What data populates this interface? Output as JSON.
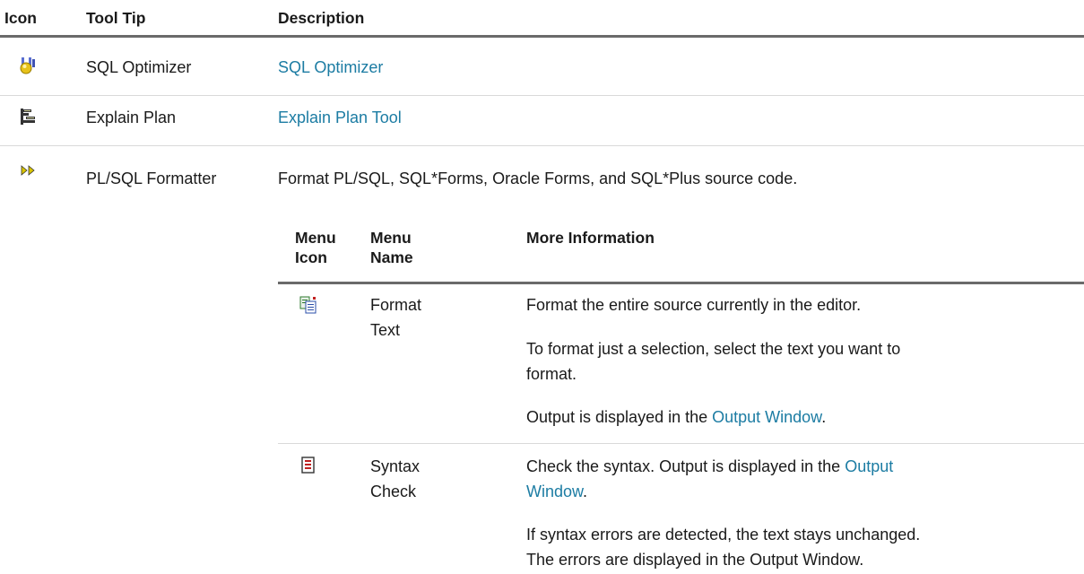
{
  "header": {
    "icon": "Icon",
    "tooltip": "Tool Tip",
    "description": "Description"
  },
  "rows": [
    {
      "icon": "sql-optimizer-icon",
      "tooltip": "SQL Optimizer",
      "link": "SQL Optimizer"
    },
    {
      "icon": "explain-plan-icon",
      "tooltip": "Explain Plan",
      "link": "Explain Plan Tool"
    },
    {
      "icon": "formatter-icon",
      "tooltip": "PL/SQL Formatter",
      "description": "Format PL/SQL, SQL*Forms, Oracle Forms, and SQL*Plus source code."
    }
  ],
  "inner": {
    "header": {
      "menu_icon_1": "Menu",
      "menu_icon_2": "Icon",
      "menu_name_1": "Menu",
      "menu_name_2": "Name",
      "more_info": "More Information"
    },
    "rows": [
      {
        "icon": "format-text-icon",
        "name_1": "Format",
        "name_2": "Text",
        "p1": "Format the entire source currently in the editor.",
        "p2_line1": "To format just a selection, select the text you want to",
        "p2_line2": "format.",
        "p3_prefix": "Output is displayed in the ",
        "p3_link": "Output Window",
        "p3_suffix": "."
      },
      {
        "icon": "syntax-check-icon",
        "name_1": "Syntax",
        "name_2": "Check",
        "p1_prefix": "Check the syntax. Output is displayed in the ",
        "p1_link_1": "Output",
        "p1_link_2": "Window",
        "p1_suffix": ".",
        "p2_line1": "If syntax errors are detected, the text stays unchanged.",
        "p2_line2": "The errors are displayed in the Output Window."
      }
    ]
  }
}
